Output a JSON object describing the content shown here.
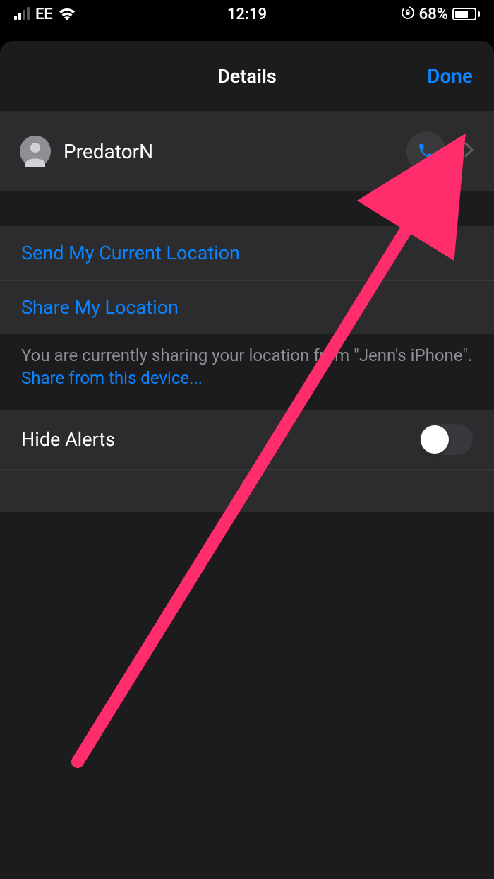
{
  "status_bar": {
    "carrier": "EE",
    "time": "12:19",
    "battery_pct": "68%"
  },
  "sheet": {
    "title": "Details",
    "done": "Done"
  },
  "contact": {
    "name": "PredatorN"
  },
  "options": {
    "send_location": "Send My Current Location",
    "share_location": "Share My Location",
    "hide_alerts": "Hide Alerts"
  },
  "footer": {
    "text": "You are currently sharing your location from \"Jenn's iPhone\".",
    "link": "Share from this device..."
  }
}
